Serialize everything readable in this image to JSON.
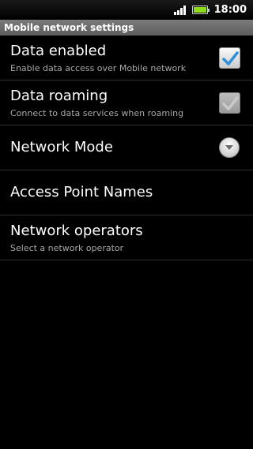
{
  "status_bar": {
    "time": "18:00",
    "battery_color": "#8fdc1e",
    "icons": [
      "signal-icon",
      "battery-icon"
    ]
  },
  "title_bar": {
    "title": "Mobile network settings"
  },
  "settings": [
    {
      "title": "Data enabled",
      "summary": "Enable data access over Mobile network",
      "control": "checkbox",
      "checked": true,
      "enabled": true
    },
    {
      "title": "Data roaming",
      "summary": "Connect to data services when roaming",
      "control": "checkbox",
      "checked": true,
      "enabled": false
    },
    {
      "title": "Network Mode",
      "control": "dropdown"
    },
    {
      "title": "Access Point Names"
    },
    {
      "title": "Network operators",
      "summary": "Select a network operator"
    }
  ],
  "colors": {
    "check_blue": "#2f8fd8",
    "check_disabled": "#8a8a8a"
  }
}
